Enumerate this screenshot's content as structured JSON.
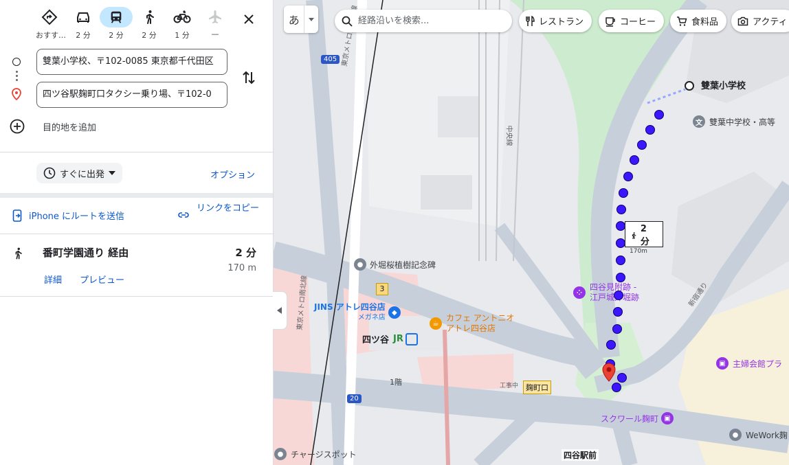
{
  "modes": [
    {
      "id": "best",
      "label": "おすす…",
      "icon": "route-diamond-icon"
    },
    {
      "id": "car",
      "label": "2 分",
      "icon": "car-icon"
    },
    {
      "id": "transit",
      "label": "2 分",
      "icon": "train-icon",
      "active": true
    },
    {
      "id": "walk",
      "label": "2 分",
      "icon": "walk-icon"
    },
    {
      "id": "bike",
      "label": "1 分",
      "icon": "bicycle-icon"
    },
    {
      "id": "flight",
      "label": "—",
      "icon": "airplane-icon"
    }
  ],
  "origin": {
    "value": "雙葉小学校、〒102-0085 東京都千代田区"
  },
  "destination": {
    "value": "四ツ谷駅麹町口タクシー乗り場、〒102-0"
  },
  "add_destination": "目的地を追加",
  "depart_label": "すぐに出発",
  "options_label": "オプション",
  "send_to_phone": "iPhone にルートを送信",
  "copy_link": "リンクをコピー",
  "route": {
    "via": "番町学園通り 経由",
    "duration": "2 分",
    "distance": "170 m",
    "details": "詳細",
    "preview": "プレビュー"
  },
  "map": {
    "lang_button": "あ",
    "search_placeholder": "経路沿いを検索...",
    "chips": [
      {
        "label": "レストラン",
        "icon": "fork-knife-icon"
      },
      {
        "label": "コーヒー",
        "icon": "coffee-icon"
      },
      {
        "label": "食料品",
        "icon": "cart-icon"
      },
      {
        "label": "アクティ",
        "icon": "camera-icon"
      }
    ],
    "walk_tooltip": {
      "time": "2 分",
      "distance": "170m"
    },
    "labels": {
      "origin_school": "雙葉小学校",
      "middle_school": "雙葉中学校・高等",
      "mitsuke": "四谷見附跡 -",
      "mitsuke2": "江戸城外堀跡",
      "sakura": "外堀桜植樹記念碑",
      "jins": "JINS アトレ四谷店",
      "jins_sub": "メガネ店",
      "cafe": "カフェ アントニオ",
      "cafe2": "アトレ四谷店",
      "station": "四ツ谷",
      "floor": "1階",
      "kojimachi": "麹町口",
      "kouji": "工事中",
      "square": "スクワール麹町",
      "housewife": "主婦会館プラ",
      "wework": "WeWork麹",
      "charge": "チャージスポット",
      "yotsuya_ekimae": "四谷駅前",
      "exit3": "3",
      "route405": "405",
      "route20": "20",
      "chuo": "中央線",
      "metro1": "東京メトロ丸ノ内線",
      "metro2": "東京メトロ南北線",
      "jr": "JR",
      "road": "新宿通り"
    }
  },
  "colors": {
    "route_dot": "#3c16ff",
    "accent": "#0b57d0",
    "destination_pin": "#ea4335",
    "park": "#cdeccf",
    "rail_area": "#f8d7d7"
  }
}
